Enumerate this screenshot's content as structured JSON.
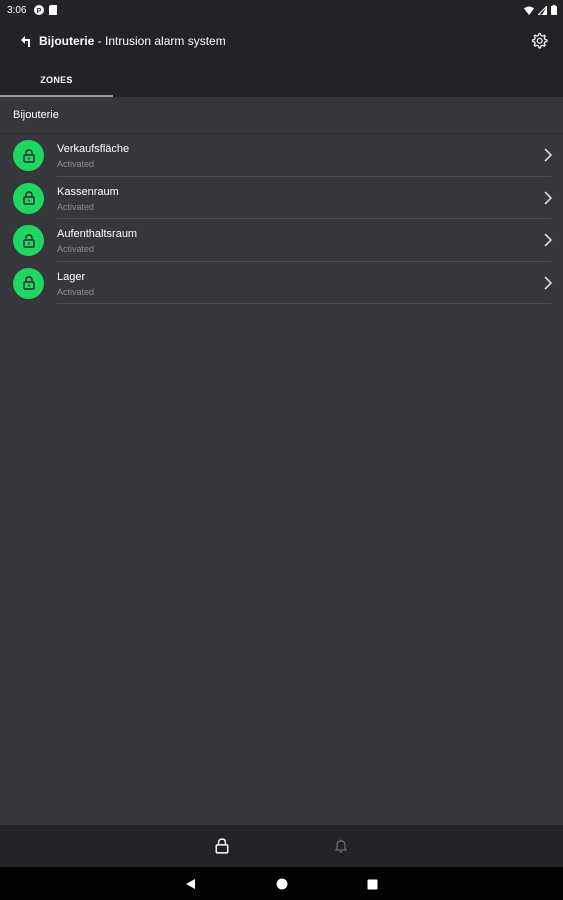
{
  "status_bar": {
    "time": "3:06",
    "icons": [
      "notification-p-icon",
      "sim-card-icon",
      "wifi-icon",
      "signal-icon",
      "battery-icon"
    ]
  },
  "app_bar": {
    "title_strong": "Bijouterie",
    "title_rest": " - Intrusion alarm system",
    "back_icon": "back-arrow-icon",
    "settings_icon": "gear-icon"
  },
  "tabs": [
    {
      "label": "ZONES",
      "selected": true
    }
  ],
  "section": {
    "title": "Bijouterie"
  },
  "zones": [
    {
      "name": "Verkaufsfläche",
      "status": "Activated"
    },
    {
      "name": "Kassenraum",
      "status": "Activated"
    },
    {
      "name": "Aufenthaltsraum",
      "status": "Activated"
    },
    {
      "name": "Lager",
      "status": "Activated"
    }
  ],
  "bottom_nav": {
    "items": [
      {
        "icon": "lock-icon",
        "active": true
      },
      {
        "icon": "bell-icon",
        "active": false
      }
    ]
  },
  "system_nav": {
    "icons": [
      "back-triangle-icon",
      "home-circle-icon",
      "recents-square-icon"
    ]
  },
  "colors": {
    "background": "#36373c",
    "bars": "#222227",
    "accent_green": "#1ed760",
    "secondary_text": "#8a8b90"
  }
}
